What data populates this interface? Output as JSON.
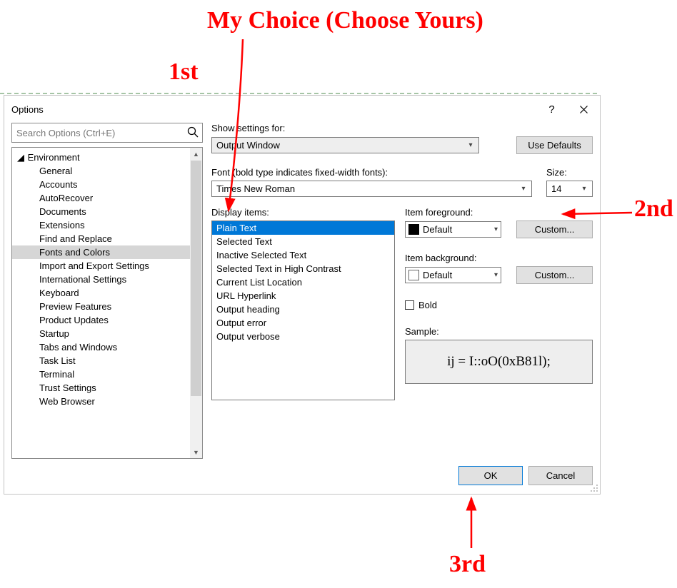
{
  "annotations": {
    "myChoice": "My Choice (Choose Yours)",
    "first": "1st",
    "second": "2nd",
    "third": "3rd"
  },
  "dialog": {
    "title": "Options",
    "help": "?",
    "search_placeholder": "Search Options (Ctrl+E)"
  },
  "tree": {
    "root": "Environment",
    "items": [
      "General",
      "Accounts",
      "AutoRecover",
      "Documents",
      "Extensions",
      "Find and Replace",
      "Fonts and Colors",
      "Import and Export Settings",
      "International Settings",
      "Keyboard",
      "Preview Features",
      "Product Updates",
      "Startup",
      "Tabs and Windows",
      "Task List",
      "Terminal",
      "Trust Settings",
      "Web Browser"
    ],
    "selected": "Fonts and Colors"
  },
  "right": {
    "showSettingsLabel": "Show settings for:",
    "showSettingsValue": "Output Window",
    "useDefaults": "Use Defaults",
    "fontLabel": "Font (bold type indicates fixed-width fonts):",
    "fontValue": "Times New Roman",
    "sizeLabel": "Size:",
    "sizeValue": "14",
    "displayItemsLabel": "Display items:",
    "displayItems": [
      "Plain Text",
      "Selected Text",
      "Inactive Selected Text",
      "Selected Text in High Contrast",
      "Current List Location",
      "URL Hyperlink",
      "Output heading",
      "Output error",
      "Output verbose"
    ],
    "displaySelected": "Plain Text",
    "foregroundLabel": "Item foreground:",
    "foregroundValue": "Default",
    "backgroundLabel": "Item background:",
    "backgroundValue": "Default",
    "customLabel": "Custom...",
    "boldLabel": "Bold",
    "sampleLabel": "Sample:",
    "sampleText": "ij = I::oO(0xB81l);"
  },
  "footer": {
    "ok": "OK",
    "cancel": "Cancel"
  }
}
